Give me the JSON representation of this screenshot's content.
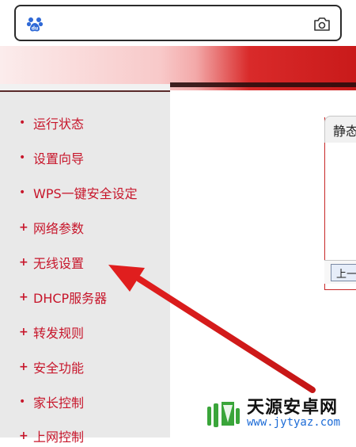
{
  "search": {
    "icon": "baidu-paw-icon",
    "camera_icon": "camera-icon"
  },
  "sidebar": {
    "items": [
      {
        "label": "运行状态",
        "bullet": "•"
      },
      {
        "label": "设置向导",
        "bullet": "•"
      },
      {
        "label": "WPS一键安全设定",
        "bullet": "•"
      },
      {
        "label": "网络参数",
        "bullet": "+"
      },
      {
        "label": "无线设置",
        "bullet": "+"
      },
      {
        "label": "DHCP服务器",
        "bullet": "+"
      },
      {
        "label": "转发规则",
        "bullet": "+"
      },
      {
        "label": "安全功能",
        "bullet": "+"
      },
      {
        "label": "家长控制",
        "bullet": "•"
      },
      {
        "label": "上网控制",
        "bullet": "+"
      }
    ]
  },
  "main": {
    "tab_label": "静态",
    "button_label": "上一"
  },
  "watermark": {
    "name": "天源安卓网",
    "url": "www.jytyaz.com"
  },
  "colors": {
    "nav_text": "#c7162b",
    "arrow": "#e01e1e",
    "sidebar_bg": "#e9e9e9"
  }
}
